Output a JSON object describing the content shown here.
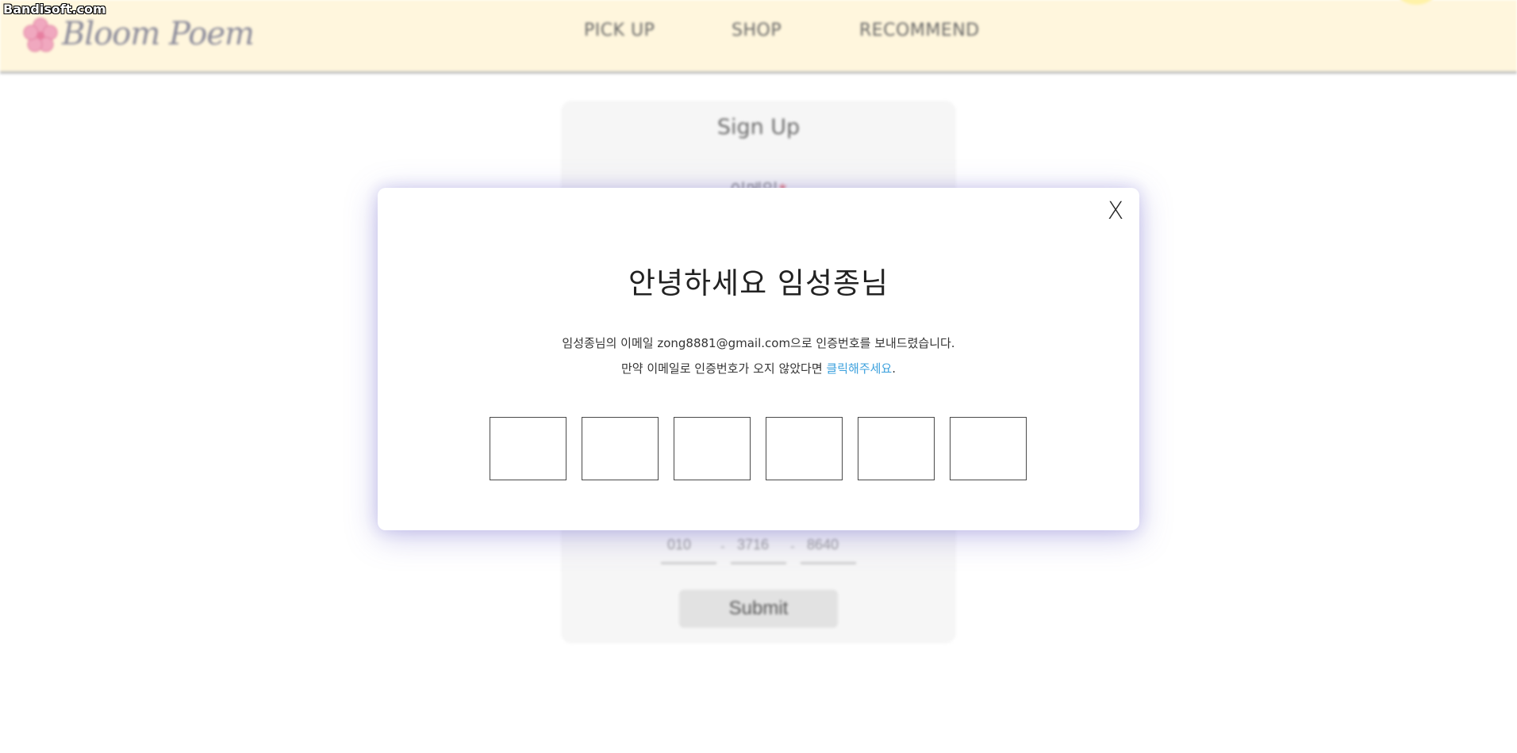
{
  "watermark": "Bandisoft.com",
  "header": {
    "logo_text": "Bloom Poem",
    "nav": {
      "pickup": "PICK UP",
      "shop": "SHOP",
      "recommend": "RECOMMEND"
    }
  },
  "signup_form": {
    "title": "Sign Up",
    "email_label": "이메일",
    "required_mark": "*",
    "phone": {
      "part1": "010",
      "part2": "3716",
      "part3": "8640",
      "separator": "-"
    },
    "submit_label": "Submit"
  },
  "modal": {
    "close_label": "X",
    "greeting": "안녕하세요 임성종님",
    "message_line1": "임성종님의 이메일 zong8881@gmail.com으로 인증번호를 보내드렸습니다.",
    "message_line2_prefix": "만약 이메일로 인증번호가 오지 않았다면 ",
    "resend_link": "클릭해주세요",
    "message_line2_suffix": ".",
    "code_boxes": [
      "",
      "",
      "",
      "",
      "",
      ""
    ]
  },
  "colors": {
    "header_bg": "#fff6dd",
    "link": "#3ba0dd",
    "modal_shadow": "#6e64c8"
  }
}
